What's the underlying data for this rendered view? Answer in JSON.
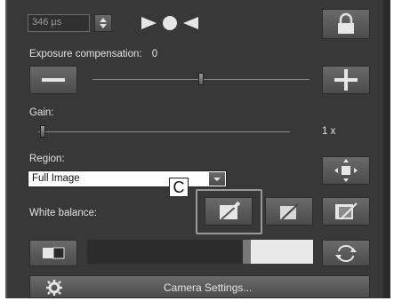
{
  "exposure": {
    "time_value": "346 µs",
    "compensation_label": "Exposure compensation:",
    "compensation_value": "0",
    "compensation_slider_level": 0.5
  },
  "gain": {
    "label": "Gain:",
    "value": "1 x",
    "slider_level": 0.0
  },
  "region": {
    "label": "Region:",
    "selected": "Full Image"
  },
  "callout": {
    "letter": "C"
  },
  "white_balance": {
    "label": "White balance:",
    "bar_level": 0.3
  },
  "footer": {
    "camera_settings_label": "Camera Settings..."
  },
  "colors": {
    "panel": "#383838",
    "button": "#5a5a5a",
    "text": "#e2e2e2",
    "highlight_border": "#9a9a9a"
  },
  "icons": [
    "spin-stepper-icon",
    "play-icon",
    "record-dot-icon",
    "reverse-icon",
    "lock-icon",
    "minus-icon",
    "plus-icon",
    "dropdown-arrow-icon",
    "center-region-icon",
    "white-balance-picker-icon",
    "gray-picker-icon",
    "white-picker-icon",
    "black-white-toggle-icon",
    "refresh-icon",
    "gear-icon"
  ]
}
